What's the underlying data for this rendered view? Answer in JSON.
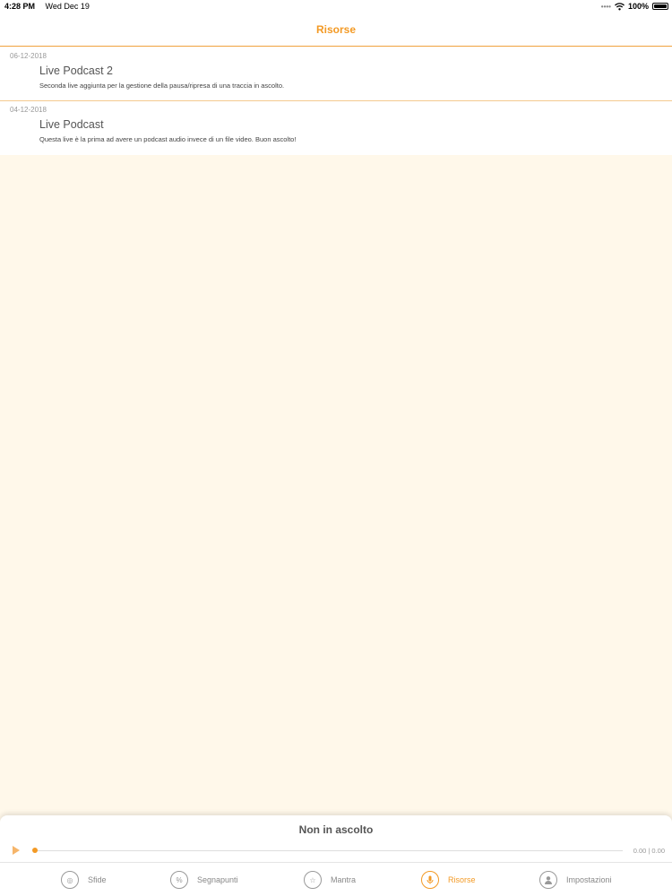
{
  "status_bar": {
    "time": "4:28 PM",
    "date": "Wed Dec 19",
    "battery": "100%"
  },
  "header": {
    "title": "Risorse"
  },
  "items": [
    {
      "date": "06-12-2018",
      "title": "Live Podcast 2",
      "description": "Seconda live aggiunta per la gestione della pausa/ripresa di una traccia in ascolto."
    },
    {
      "date": "04-12-2018",
      "title": "Live Podcast",
      "description": "Questa live è la prima ad avere un podcast audio invece di un file video. Buon ascolto!"
    }
  ],
  "player": {
    "status": "Non in ascolto",
    "time": "0.00 | 0.00",
    "progress": 0
  },
  "tabs": [
    {
      "label": "Sfide",
      "icon": "target-icon"
    },
    {
      "label": "Segnapunti",
      "icon": "percent-icon"
    },
    {
      "label": "Mantra",
      "icon": "star-person-icon"
    },
    {
      "label": "Risorse",
      "icon": "microphone-icon",
      "active": true
    },
    {
      "label": "Impostazioni",
      "icon": "user-icon"
    }
  ],
  "colors": {
    "accent": "#f39a25",
    "background": "#fff8ea"
  }
}
